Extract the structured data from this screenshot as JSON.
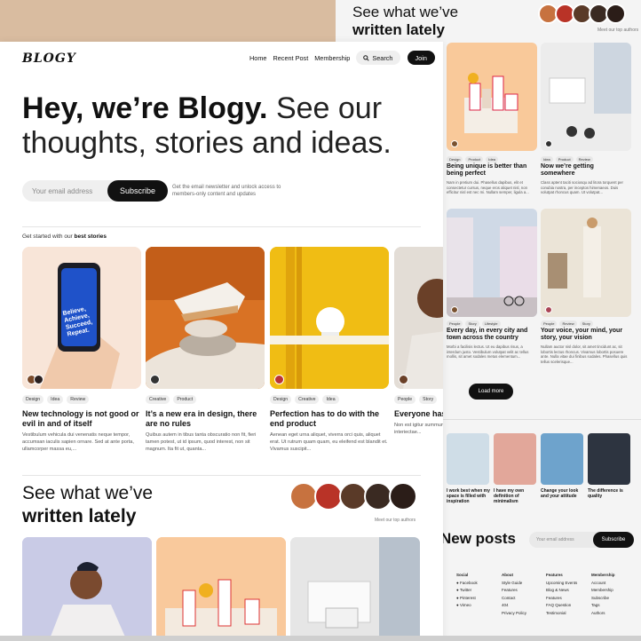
{
  "front": {
    "logo": "BLOGY",
    "nav": {
      "home": "Home",
      "recent": "Recent Post",
      "membership": "Membership",
      "search": "Search",
      "join": "Join"
    },
    "hero": {
      "bold": "Hey, we’re Blogy.",
      "rest": " See our thoughts, stories and ideas."
    },
    "subscribe": {
      "placeholder": "Your email address",
      "button": "Subscribe",
      "note": "Get the email newsletter and unlock access to members-only content and updates"
    },
    "started": {
      "prefix": "Get started with our",
      "bold": "best stories"
    },
    "cards": [
      {
        "tags": [
          "Design",
          "Idea",
          "Review"
        ],
        "title": "New technology is not good or evil in and of itself",
        "desc": "Vestibulum vehicula dui venenatis neque tempor, accumsan iaculis sapien ornare. Sed at ante porta, ullamcorper massa eu,..."
      },
      {
        "tags": [
          "Creative",
          "Product"
        ],
        "title": "It’s a new era in design, there are no rules",
        "desc": "Quibus autem in tibus tanta obscuratio non fit, fieri tamen potest, ut id ipsum, quod interest, non sit magnum. Ita fit ut, quanta..."
      },
      {
        "tags": [
          "Design",
          "Creative",
          "Idea"
        ],
        "title": "Perfection has to do with the end product",
        "desc": "Aenean eget urna aliquet, viverra orci quis, aliquet erat. Ut rutrum quam quam, eu eleifend est blandit et. Vivamus suscipit..."
      },
      {
        "tags": [
          "People",
          "Story"
        ],
        "title": "Everyone has...",
        "desc": "Non est igitur summum autem inter haec ta hominum interiectae..."
      }
    ],
    "phone_text": "Believe, Achieve, Succeed, Repeat.",
    "written": {
      "line1": "See what we’ve",
      "line2": "written lately"
    },
    "meet": "Meet our top authors"
  },
  "back": {
    "written": {
      "line1": "See what we’ve",
      "line2": "written lately"
    },
    "meet": "Meet our top authors",
    "cards": [
      {
        "tags": [
          "Design",
          "Product",
          "Idea"
        ],
        "title": "Being unique is better than being perfect",
        "desc": "Nam in pretium dui. Phasellus dapibus, elit et consectetur cursus, neque eros aliquet nisl, non efficitur nisl est nec mi. Nullam semper, ligula a..."
      },
      {
        "tags": [
          "Idea",
          "Product",
          "Review"
        ],
        "title": "Now we’re getting somewhere",
        "desc": "Class aptent taciti sociosqu ad litora torquent per conubia nostra, per inceptos himenaeos. Duis volutpat rhoncus quam. Ut volutpat..."
      },
      {
        "tags": [
          "People",
          "Story",
          "Lifestyle"
        ],
        "title": "Every day, in every city and town across the country",
        "desc": "Morbi a facilisis lectus. Ut eu dapibus risus, a interdum justo. Vestibulum volutpat velit ac tellus mollis, sit amet sodales metus elementum..."
      },
      {
        "tags": [
          "People",
          "Review",
          "Story"
        ],
        "title": "Your voice, your mind, your story, your vision",
        "desc": "Nullam auctor nisl dolor, sit amet tincidunt ac, sit lobortis lectus rhoncus. Vivamus lobortis posuere ante. Nulla vitae dui finibus sodales. Phasellus quis tellus scelerisque..."
      }
    ],
    "load_more": "Load more",
    "small_cards": [
      {
        "title": "I work best when my space is filled with inspiration"
      },
      {
        "title": "I have my own definition of minimalism"
      },
      {
        "title": "Change your look and your attitude"
      },
      {
        "title": "The difference is quality"
      }
    ],
    "new_posts": "New posts",
    "subscribe": {
      "placeholder": "Your email address",
      "button": "Subscribe"
    },
    "footer": {
      "social": {
        "head": "Social",
        "items": [
          "Facebook",
          "Twitter",
          "Pinterest",
          "Vimeo"
        ]
      },
      "about": {
        "head": "About",
        "items": [
          "Style Guide",
          "Features",
          "Contact",
          "404",
          "Privacy Policy"
        ]
      },
      "features": {
        "head": "Features",
        "items": [
          "Upcoming Events",
          "Blog & News",
          "Features",
          "FAQ Question",
          "Testimonial"
        ]
      },
      "membership": {
        "head": "Membership",
        "items": [
          "Account",
          "Membership",
          "Subscribe",
          "Tags",
          "Authors"
        ]
      }
    }
  },
  "colors": {
    "accent": "#111111",
    "peach": "#f8c89a",
    "yellow": "#f2c318",
    "orange": "#e2801e"
  }
}
